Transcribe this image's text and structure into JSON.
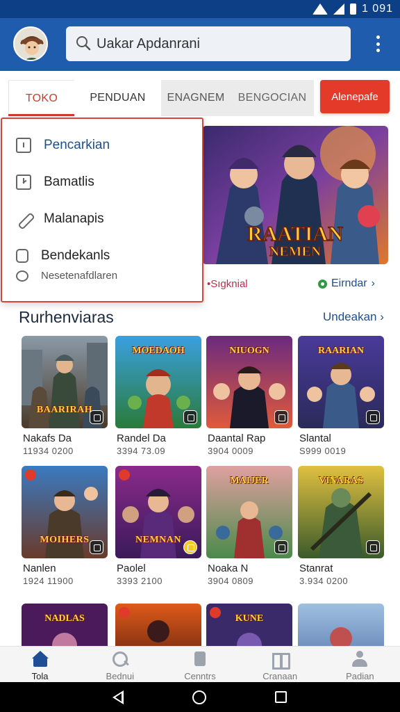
{
  "status_bar": {
    "time": "1 091"
  },
  "app_bar": {
    "search_text": "Uakar Apdanrani",
    "avatar_icon": "user-avatar",
    "menu_icon": "more-vert-icon"
  },
  "tabs": [
    "TOKO",
    "PENDUAN",
    "ENAGNEM",
    "BENGOCIAN"
  ],
  "cta_label": "Alenepafe",
  "dropdown": {
    "items": [
      {
        "label": "Pencarkian",
        "icon": "square-icon"
      },
      {
        "label": "Bamatlis",
        "icon": "clock-icon"
      },
      {
        "label": "Malanapis",
        "icon": "pen-icon"
      },
      {
        "label": "Bendekanls",
        "icon": "box-icon"
      },
      {
        "label": "Nesetenafdlaren",
        "icon": "circle-icon"
      }
    ]
  },
  "banner": {
    "title_line1": "RAATIAN",
    "title_line2": "NEMEN",
    "caption_left": "•Sıgknial",
    "caption_right": "Eirndar"
  },
  "section": {
    "title": "Rurhenviaras",
    "link": "Undeakan"
  },
  "apps": [
    {
      "title": "Nakafs Da",
      "meta": "11934   0200",
      "art_top": "",
      "art_bottom": "BAARIRAH"
    },
    {
      "title": "Randel Da",
      "meta": "3394   73.09",
      "art_top": "MOEDAOH",
      "art_bottom": ""
    },
    {
      "title": "Daantal Rap",
      "meta": "3904   0009",
      "art_top": "NIUOGN",
      "art_bottom": ""
    },
    {
      "title": "Slantal",
      "meta": "S999   0019",
      "art_top": "RAARIAN",
      "art_bottom": ""
    },
    {
      "title": "Nanlen",
      "meta": "1924   11900",
      "art_top": "",
      "art_bottom": "MOIHERS"
    },
    {
      "title": "Paolel",
      "meta": "3393   2100",
      "art_top": "",
      "art_bottom": "NEMNAN"
    },
    {
      "title": "Noaka N",
      "meta": "3904   0809",
      "art_top": "MAIJER",
      "art_bottom": ""
    },
    {
      "title": "Stanrat",
      "meta": "3.934   0200",
      "art_top": "VINARAS",
      "art_bottom": ""
    },
    {
      "title": "",
      "meta": "",
      "art_top": "NADLAS",
      "art_bottom": ""
    },
    {
      "title": "",
      "meta": "",
      "art_top": "",
      "art_bottom": ""
    },
    {
      "title": "",
      "meta": "",
      "art_top": "KUNE",
      "art_bottom": ""
    },
    {
      "title": "",
      "meta": "",
      "art_top": "",
      "art_bottom": ""
    }
  ],
  "bottom_nav": [
    {
      "label": "Tola",
      "icon": "home-icon"
    },
    {
      "label": "Bednui",
      "icon": "search-icon"
    },
    {
      "label": "Cenntrs",
      "icon": "document-icon"
    },
    {
      "label": "Cranaan",
      "icon": "grid-icon"
    },
    {
      "label": "Padian",
      "icon": "person-icon"
    }
  ]
}
